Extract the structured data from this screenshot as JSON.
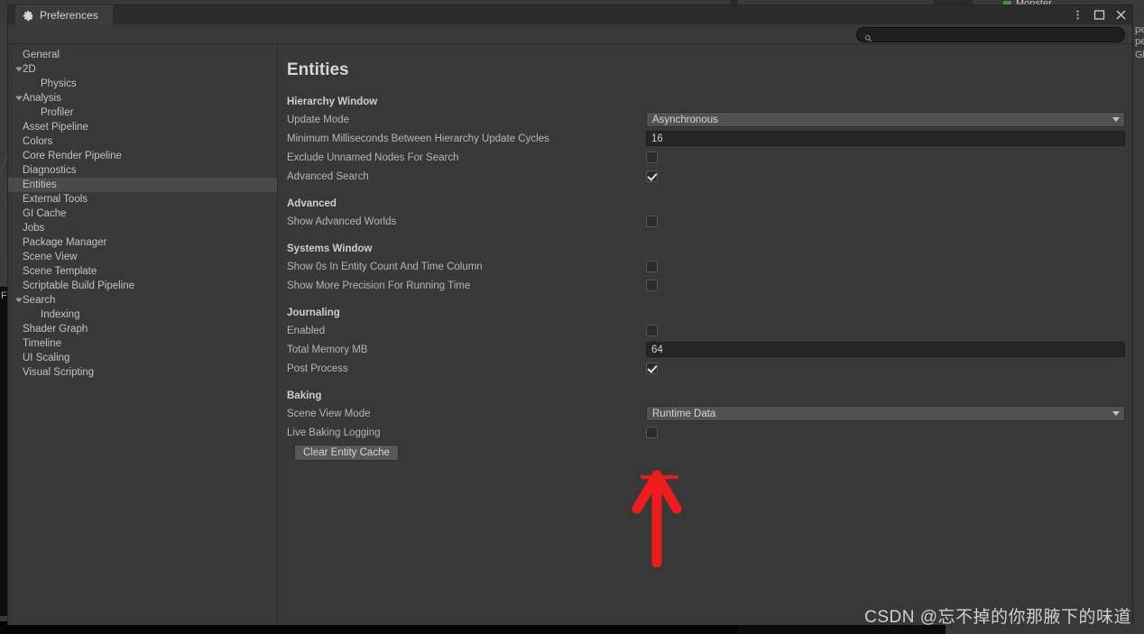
{
  "window": {
    "tab_label": "Preferences",
    "tab_icon": "gear-icon",
    "controls": {
      "menu": "kebab-menu-icon",
      "maximize": "maximize-icon",
      "close": "close-icon"
    }
  },
  "search": {
    "placeholder": "",
    "value": "",
    "icon": "search-icon"
  },
  "sidebar": {
    "items": [
      {
        "label": "General",
        "level": 1,
        "expandable": false,
        "selected": false
      },
      {
        "label": "2D",
        "level": 1,
        "expandable": true,
        "selected": false
      },
      {
        "label": "Physics",
        "level": 2,
        "expandable": false,
        "selected": false
      },
      {
        "label": "Analysis",
        "level": 1,
        "expandable": true,
        "selected": false
      },
      {
        "label": "Profiler",
        "level": 2,
        "expandable": false,
        "selected": false
      },
      {
        "label": "Asset Pipeline",
        "level": 1,
        "expandable": false,
        "selected": false
      },
      {
        "label": "Colors",
        "level": 1,
        "expandable": false,
        "selected": false
      },
      {
        "label": "Core Render Pipeline",
        "level": 1,
        "expandable": false,
        "selected": false
      },
      {
        "label": "Diagnostics",
        "level": 1,
        "expandable": false,
        "selected": false
      },
      {
        "label": "Entities",
        "level": 1,
        "expandable": false,
        "selected": true
      },
      {
        "label": "External Tools",
        "level": 1,
        "expandable": false,
        "selected": false
      },
      {
        "label": "GI Cache",
        "level": 1,
        "expandable": false,
        "selected": false
      },
      {
        "label": "Jobs",
        "level": 1,
        "expandable": false,
        "selected": false
      },
      {
        "label": "Package Manager",
        "level": 1,
        "expandable": false,
        "selected": false
      },
      {
        "label": "Scene View",
        "level": 1,
        "expandable": false,
        "selected": false
      },
      {
        "label": "Scene Template",
        "level": 1,
        "expandable": false,
        "selected": false
      },
      {
        "label": "Scriptable Build Pipeline",
        "level": 1,
        "expandable": false,
        "selected": false
      },
      {
        "label": "Search",
        "level": 1,
        "expandable": true,
        "selected": false
      },
      {
        "label": "Indexing",
        "level": 2,
        "expandable": false,
        "selected": false
      },
      {
        "label": "Shader Graph",
        "level": 1,
        "expandable": false,
        "selected": false
      },
      {
        "label": "Timeline",
        "level": 1,
        "expandable": false,
        "selected": false
      },
      {
        "label": "UI Scaling",
        "level": 1,
        "expandable": false,
        "selected": false
      },
      {
        "label": "Visual Scripting",
        "level": 1,
        "expandable": false,
        "selected": false
      }
    ]
  },
  "content": {
    "title": "Entities",
    "groups": [
      {
        "header": "Hierarchy Window",
        "rows": [
          {
            "label": "Update Mode",
            "control": "popup",
            "value": "Asynchronous"
          },
          {
            "label": "Minimum Milliseconds Between Hierarchy Update Cycles",
            "control": "number",
            "value": "16"
          },
          {
            "label": "Exclude Unnamed Nodes For Search",
            "control": "checkbox",
            "checked": false
          },
          {
            "label": "Advanced Search",
            "control": "checkbox",
            "checked": true
          }
        ]
      },
      {
        "header": "Advanced",
        "rows": [
          {
            "label": "Show Advanced Worlds",
            "control": "checkbox",
            "checked": false
          }
        ]
      },
      {
        "header": "Systems Window",
        "rows": [
          {
            "label": "Show 0s In Entity Count And Time Column",
            "control": "checkbox",
            "checked": false
          },
          {
            "label": "Show More Precision For Running Time",
            "control": "checkbox",
            "checked": false
          }
        ]
      },
      {
        "header": "Journaling",
        "rows": [
          {
            "label": "Enabled",
            "control": "checkbox",
            "checked": false
          },
          {
            "label": "Total Memory MB",
            "control": "number",
            "value": "64"
          },
          {
            "label": "Post Process",
            "control": "checkbox",
            "checked": true
          }
        ]
      },
      {
        "header": "Baking",
        "rows": [
          {
            "label": "Scene View Mode",
            "control": "popup",
            "value": "Runtime Data"
          },
          {
            "label": "Live Baking Logging",
            "control": "checkbox",
            "checked": false
          },
          {
            "label": "Clear Entity Cache",
            "control": "button"
          }
        ]
      }
    ]
  },
  "annotation": {
    "type": "arrow-up",
    "color": "#ee1c1c",
    "target": "Scene View Mode dropdown"
  },
  "background": {
    "tab_label": "Monster",
    "right_fragments": [
      "pe",
      "pe",
      "Gl"
    ],
    "left_fragment": "F"
  },
  "watermark": {
    "text": "CSDN @忘不掉的你那腋下的味道"
  }
}
